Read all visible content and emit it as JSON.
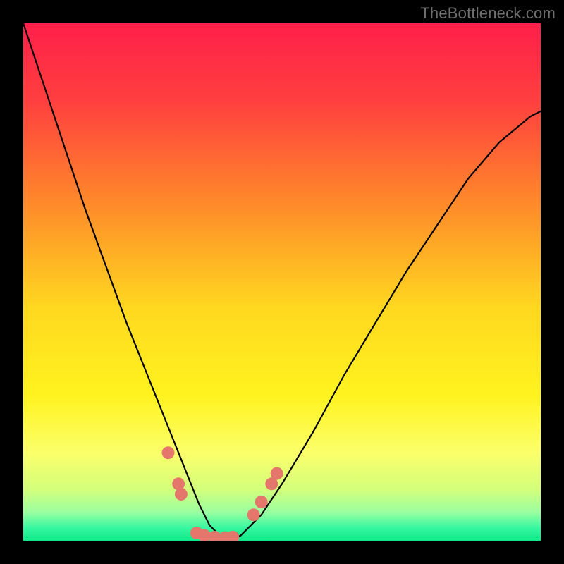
{
  "watermark": "TheBottleneck.com",
  "chart_data": {
    "type": "line",
    "title": "",
    "xlabel": "",
    "ylabel": "",
    "xlim": [
      0,
      100
    ],
    "ylim": [
      0,
      100
    ],
    "series": [
      {
        "name": "curve",
        "x": [
          0,
          4,
          8,
          12,
          16,
          20,
          24,
          28,
          30,
          32,
          34,
          36,
          38,
          40,
          42,
          46,
          50,
          56,
          62,
          68,
          74,
          80,
          86,
          92,
          98,
          100
        ],
        "values": [
          100,
          88,
          76,
          64,
          53,
          42,
          32,
          22,
          17,
          12,
          7,
          3,
          1,
          0,
          1,
          5,
          11,
          21,
          32,
          42,
          52,
          61,
          70,
          77,
          82,
          83
        ]
      }
    ],
    "points": [
      {
        "x": 28.0,
        "y": 17.0
      },
      {
        "x": 30.0,
        "y": 11.0
      },
      {
        "x": 30.5,
        "y": 9.0
      },
      {
        "x": 33.5,
        "y": 1.5
      },
      {
        "x": 35.0,
        "y": 1.0
      },
      {
        "x": 37.0,
        "y": 0.7
      },
      {
        "x": 39.0,
        "y": 0.6
      },
      {
        "x": 40.5,
        "y": 0.7
      },
      {
        "x": 44.5,
        "y": 5.0
      },
      {
        "x": 46.0,
        "y": 7.5
      },
      {
        "x": 48.0,
        "y": 11.0
      },
      {
        "x": 49.0,
        "y": 13.0
      }
    ],
    "point_color": "#e4766b",
    "curve_color": "#000000",
    "gradient_stops": [
      {
        "offset": 0.0,
        "color": "#ff1f4a"
      },
      {
        "offset": 0.15,
        "color": "#ff3f3f"
      },
      {
        "offset": 0.35,
        "color": "#ff8a2a"
      },
      {
        "offset": 0.55,
        "color": "#ffd81f"
      },
      {
        "offset": 0.72,
        "color": "#fff31f"
      },
      {
        "offset": 0.83,
        "color": "#fbff6a"
      },
      {
        "offset": 0.9,
        "color": "#d4ff7a"
      },
      {
        "offset": 0.945,
        "color": "#9bffa0"
      },
      {
        "offset": 0.975,
        "color": "#36f7a0"
      },
      {
        "offset": 1.0,
        "color": "#10e887"
      }
    ]
  }
}
